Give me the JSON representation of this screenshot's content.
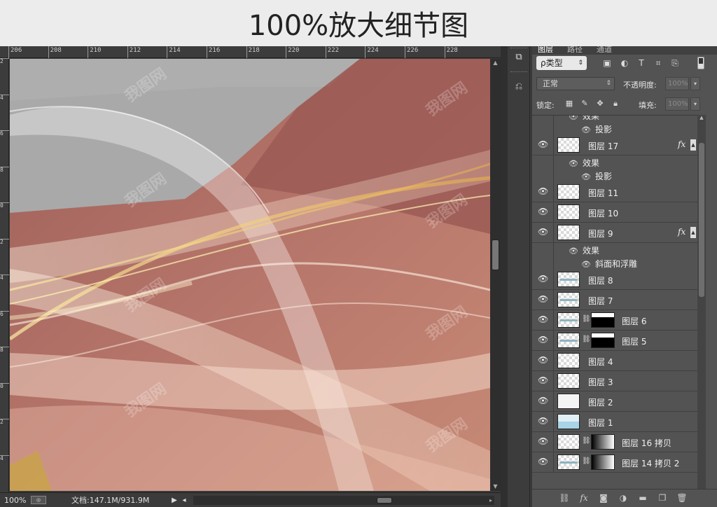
{
  "banner": {
    "title": "100%放大细节图"
  },
  "rulers": {
    "horizontal": [
      "206",
      "208",
      "210",
      "212",
      "214",
      "216",
      "218",
      "220",
      "222",
      "224",
      "226",
      "228"
    ],
    "vertical": [
      "2",
      "4",
      "6",
      "8",
      "0",
      "2",
      "4",
      "6",
      "8",
      "0",
      "2",
      "4"
    ]
  },
  "status": {
    "zoom": "100%",
    "doc": "文档:147.1M/931.9M",
    "proof_icon": "soft-proof-icon"
  },
  "panel": {
    "tabs": [
      "图层",
      "路径",
      "通道"
    ],
    "filter": {
      "label": "ρ类型"
    },
    "blend_mode": "正常",
    "opacity_label": "不透明度:",
    "opacity_value": "100%",
    "lock_label": "锁定:",
    "fill_label": "填充:",
    "fill_value": "100%"
  },
  "layers": [
    {
      "type": "effect",
      "label": "效果"
    },
    {
      "type": "effect-item",
      "label": "投影"
    },
    {
      "type": "layer",
      "name": "图层 17",
      "thumb": "checker",
      "fx": "fx"
    },
    {
      "type": "effect",
      "label": "效果"
    },
    {
      "type": "effect-item",
      "label": "投影"
    },
    {
      "type": "layer",
      "name": "图层 11",
      "thumb": "checker"
    },
    {
      "type": "layer",
      "name": "图层 10",
      "thumb": "checker"
    },
    {
      "type": "layer",
      "name": "图层 9",
      "thumb": "checker",
      "fx": "fx"
    },
    {
      "type": "effect",
      "label": "效果"
    },
    {
      "type": "effect-item",
      "label": "斜面和浮雕"
    },
    {
      "type": "layer",
      "name": "图层 8",
      "thumb": "mark"
    },
    {
      "type": "layer",
      "name": "图层 7",
      "thumb": "mark"
    },
    {
      "type": "layer",
      "name": "图层 6",
      "thumb": "mark",
      "mask": "white-black"
    },
    {
      "type": "layer",
      "name": "图层 5",
      "thumb": "mark",
      "mask": "white-black"
    },
    {
      "type": "layer",
      "name": "图层 4",
      "thumb": "checker"
    },
    {
      "type": "layer",
      "name": "图层 3",
      "thumb": "checker"
    },
    {
      "type": "layer",
      "name": "图层 2",
      "thumb": "gray"
    },
    {
      "type": "layer",
      "name": "图层 1",
      "thumb": "blue"
    },
    {
      "type": "layer",
      "name": "图层 16 拷贝",
      "thumb": "checker",
      "mask": "gradient"
    },
    {
      "type": "layer",
      "name": "图层 14 拷贝 2",
      "thumb": "mark",
      "mask": "gradient"
    }
  ],
  "colors": {
    "canvas_rose": "#b97a6c",
    "canvas_gray": "#a5a5a5",
    "panel_bg": "#535353",
    "silk_highlight": "#f5e6c8",
    "gold_streak": "#e8c25a"
  }
}
